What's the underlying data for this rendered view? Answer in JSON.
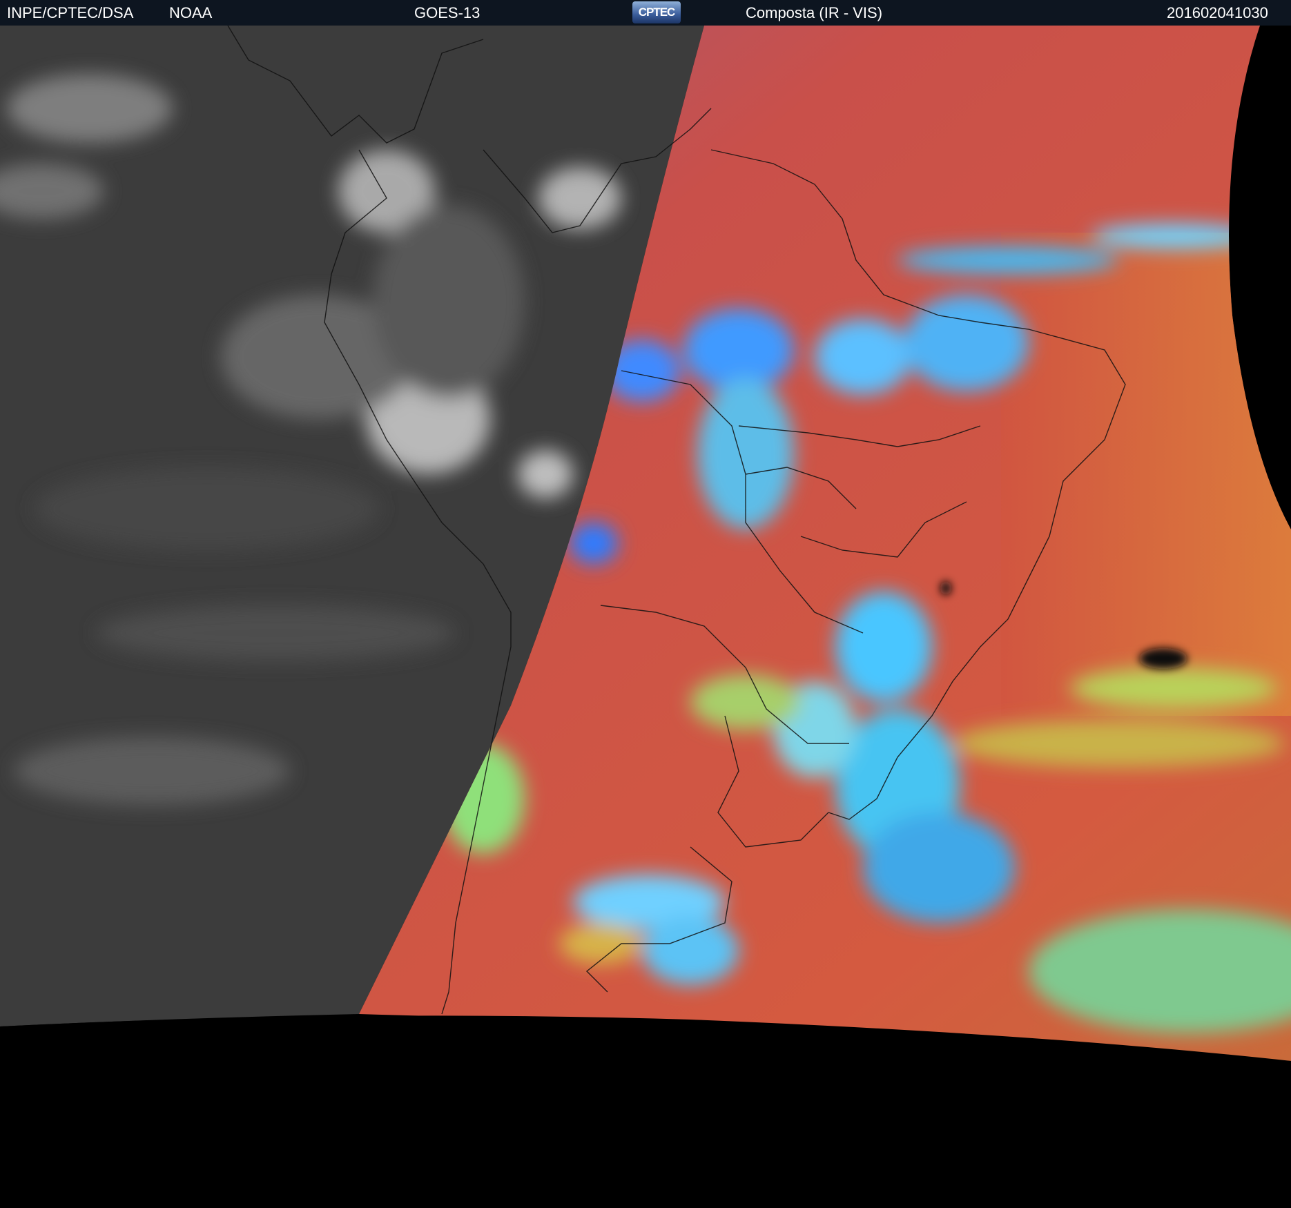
{
  "header": {
    "agency": "INPE/CPTEC/DSA",
    "source": "NOAA",
    "satellite": "GOES-13",
    "logo_text": "CPTEC",
    "product": "Composta (IR - VIS)",
    "timestamp": "201602041030"
  },
  "image": {
    "description_colors": {
      "header_bg": "#0d1520",
      "night_side": "#3a3a3a",
      "day_land": "#c8504a",
      "cloud_blue": "#3fb8ff",
      "cloud_green": "#8fe07a",
      "space": "#000000"
    }
  }
}
